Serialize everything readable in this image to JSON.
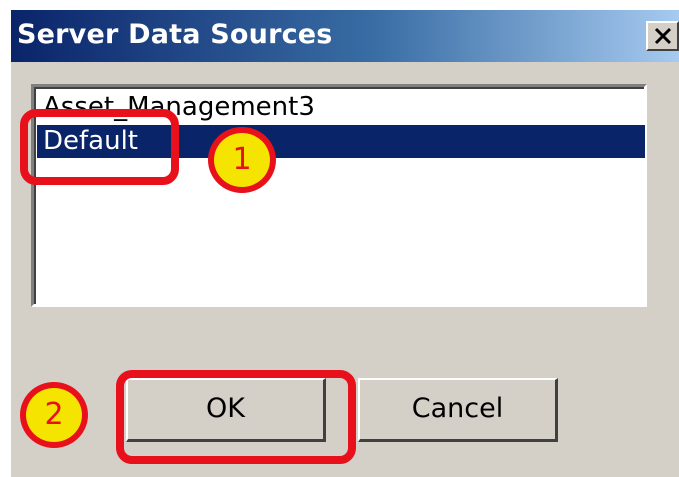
{
  "window": {
    "title": "Server Data Sources",
    "close_label": "✕"
  },
  "list": {
    "items": [
      "Asset_Management3",
      "Default"
    ],
    "selected": "Default"
  },
  "buttons": {
    "ok": "OK",
    "cancel": "Cancel"
  },
  "annotations": {
    "step1": "1",
    "step2": "2"
  },
  "colors": {
    "selection": "#0a246a",
    "annotation_red": "#e8101a",
    "annotation_yellow": "#f5e400"
  }
}
